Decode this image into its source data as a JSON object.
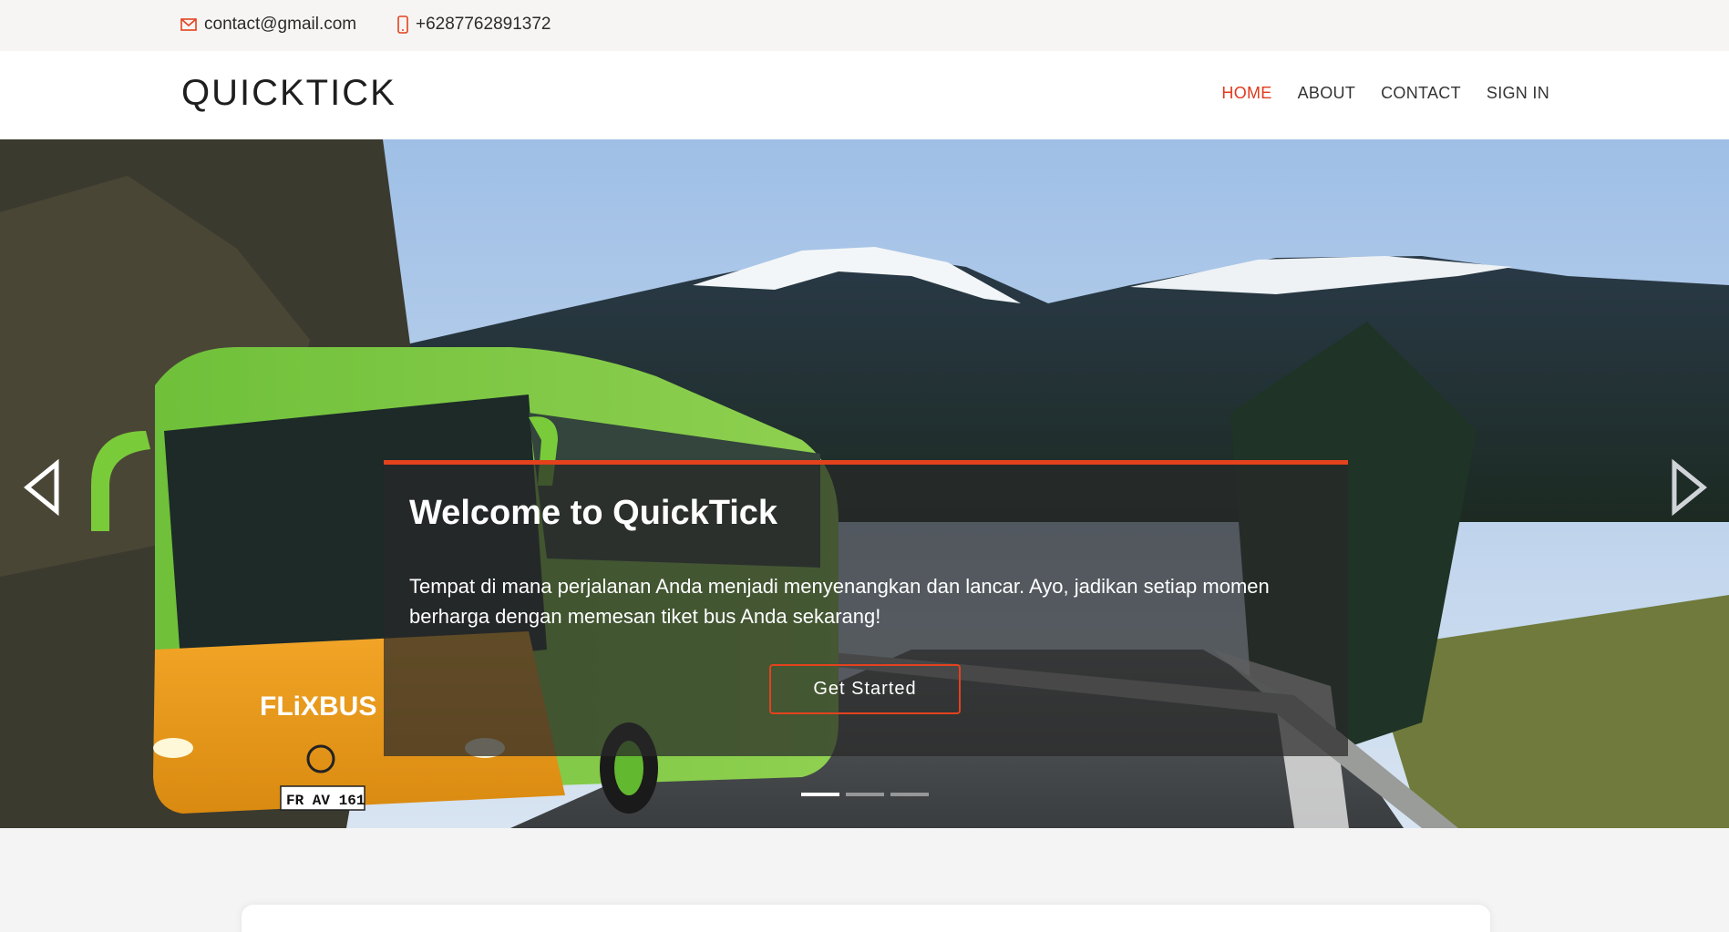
{
  "contact": {
    "email": "contact@gmail.com",
    "phone": "+6287762891372",
    "email_icon": "mail-icon",
    "phone_icon": "phone-icon"
  },
  "header": {
    "logo": "QUICKTICK",
    "nav": [
      {
        "label": "HOME",
        "active": true
      },
      {
        "label": "ABOUT",
        "active": false
      },
      {
        "label": "CONTACT",
        "active": false
      },
      {
        "label": "SIGN IN",
        "active": false
      }
    ]
  },
  "hero": {
    "title": "Welcome to QuickTick",
    "text": "Tempat di mana perjalanan Anda menjadi menyenangkan dan lancar. Ayo, jadikan setiap momen berharga dengan memesan tiket bus Anda sekarang!",
    "button_label": "Get Started",
    "bus_brand": "FLiXBUS",
    "bus_plate": "FR AV 161",
    "slides": 3,
    "active_slide": 1
  },
  "colors": {
    "accent": "#e4421d",
    "nav_active": "#e03a1e",
    "topbar_bg": "#f6f5f3",
    "page_bg": "#f4f4f4"
  }
}
